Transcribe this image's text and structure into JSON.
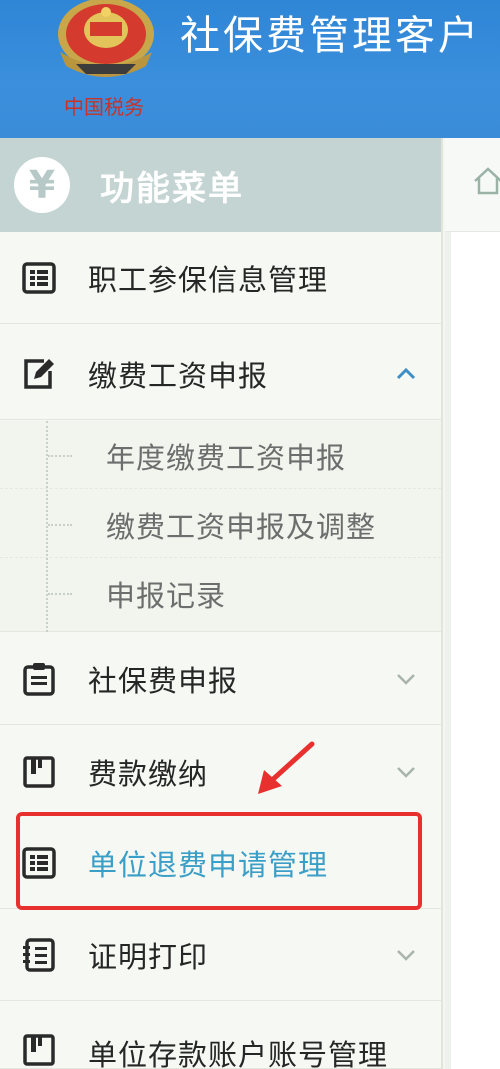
{
  "app": {
    "title": "社保费管理客户"
  },
  "emblem": {
    "caption": "中国税务"
  },
  "menu": {
    "title": "功能菜单",
    "icon": "yen-icon",
    "items": [
      {
        "label": "职工参保信息管理",
        "icon": "grid-list-icon"
      },
      {
        "label": "缴费工资申报",
        "icon": "edit-icon",
        "expanded": true
      },
      {
        "label": "社保费申报",
        "icon": "clipboard-icon"
      },
      {
        "label": "费款缴纳",
        "icon": "book-icon"
      },
      {
        "label": "单位退费申请管理",
        "icon": "grid-list-icon",
        "selected": true
      },
      {
        "label": "证明打印",
        "icon": "document-list-icon"
      },
      {
        "label": "单位存款账户账号管理",
        "icon": "book-icon"
      }
    ],
    "submenu": [
      {
        "label": "年度缴费工资申报"
      },
      {
        "label": "缴费工资申报及调整"
      },
      {
        "label": "申报记录"
      }
    ]
  },
  "colors": {
    "header": "#3a8cd8",
    "menu_head": "#c3d4d2",
    "selected_text": "#3a9ec7",
    "highlight": "#e8302e"
  }
}
